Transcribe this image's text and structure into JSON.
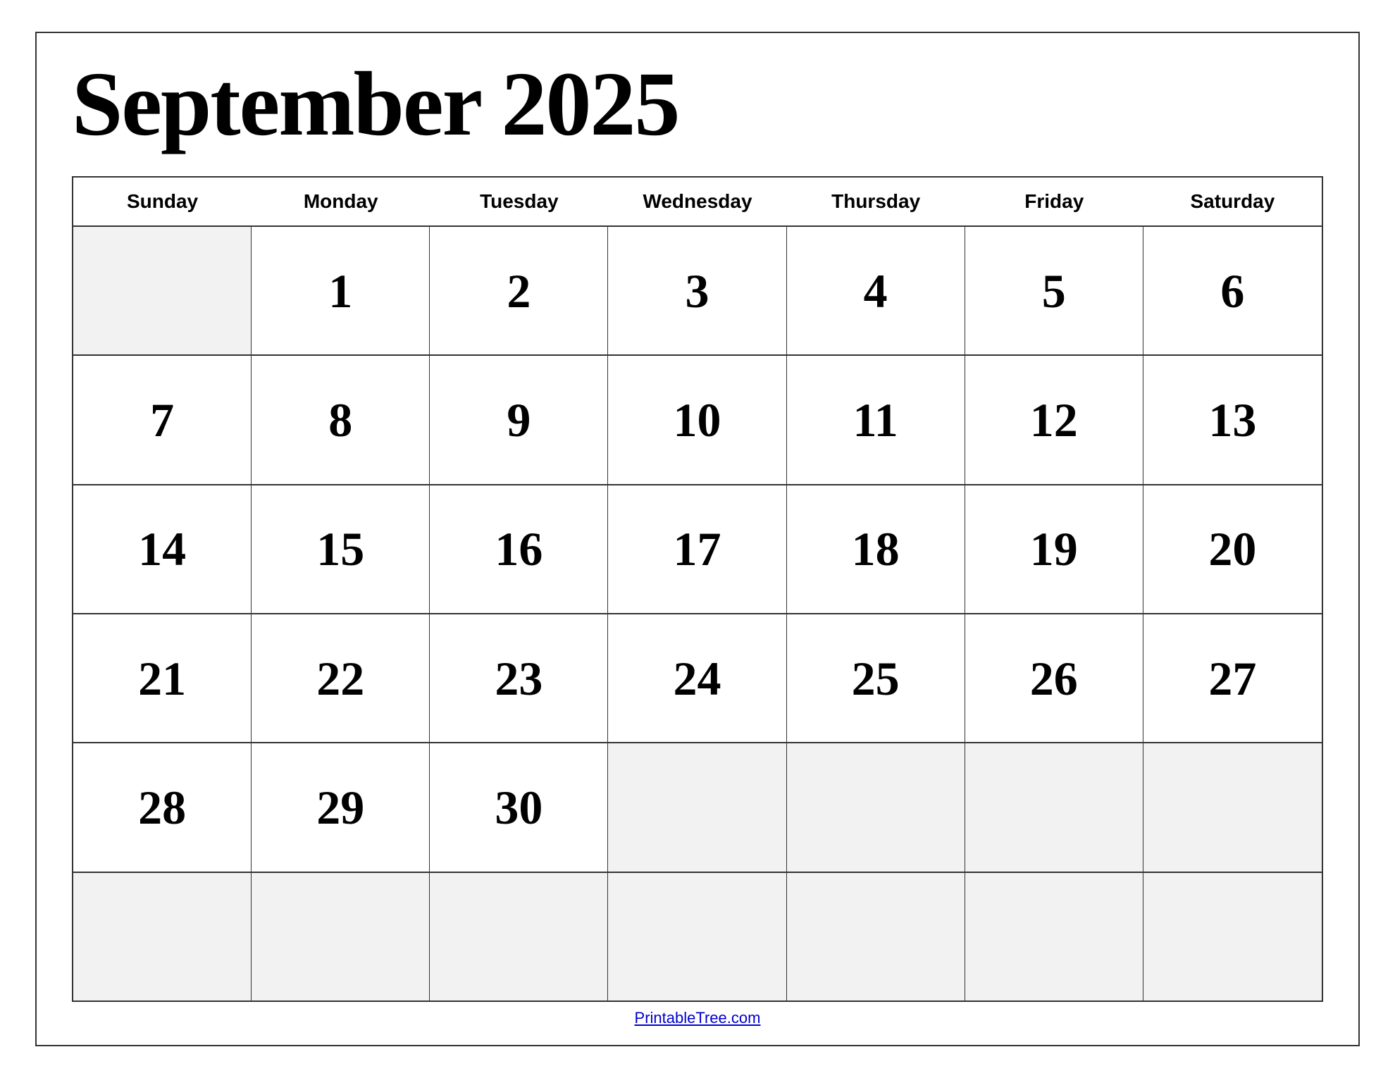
{
  "calendar": {
    "title": "September 2025",
    "month": "September",
    "year": "2025",
    "day_headers": [
      "Sunday",
      "Monday",
      "Tuesday",
      "Wednesday",
      "Thursday",
      "Friday",
      "Saturday"
    ],
    "weeks": [
      [
        {
          "day": "",
          "empty": true
        },
        {
          "day": "1",
          "empty": false
        },
        {
          "day": "2",
          "empty": false
        },
        {
          "day": "3",
          "empty": false
        },
        {
          "day": "4",
          "empty": false
        },
        {
          "day": "5",
          "empty": false
        },
        {
          "day": "6",
          "empty": false
        }
      ],
      [
        {
          "day": "7",
          "empty": false
        },
        {
          "day": "8",
          "empty": false
        },
        {
          "day": "9",
          "empty": false
        },
        {
          "day": "10",
          "empty": false
        },
        {
          "day": "11",
          "empty": false
        },
        {
          "day": "12",
          "empty": false
        },
        {
          "day": "13",
          "empty": false
        }
      ],
      [
        {
          "day": "14",
          "empty": false
        },
        {
          "day": "15",
          "empty": false
        },
        {
          "day": "16",
          "empty": false
        },
        {
          "day": "17",
          "empty": false
        },
        {
          "day": "18",
          "empty": false
        },
        {
          "day": "19",
          "empty": false
        },
        {
          "day": "20",
          "empty": false
        }
      ],
      [
        {
          "day": "21",
          "empty": false
        },
        {
          "day": "22",
          "empty": false
        },
        {
          "day": "23",
          "empty": false
        },
        {
          "day": "24",
          "empty": false
        },
        {
          "day": "25",
          "empty": false
        },
        {
          "day": "26",
          "empty": false
        },
        {
          "day": "27",
          "empty": false
        }
      ],
      [
        {
          "day": "28",
          "empty": false
        },
        {
          "day": "29",
          "empty": false
        },
        {
          "day": "30",
          "empty": false
        },
        {
          "day": "",
          "empty": true
        },
        {
          "day": "",
          "empty": true
        },
        {
          "day": "",
          "empty": true
        },
        {
          "day": "",
          "empty": true
        }
      ],
      [
        {
          "day": "",
          "empty": true
        },
        {
          "day": "",
          "empty": true
        },
        {
          "day": "",
          "empty": true
        },
        {
          "day": "",
          "empty": true
        },
        {
          "day": "",
          "empty": true
        },
        {
          "day": "",
          "empty": true
        },
        {
          "day": "",
          "empty": true
        }
      ]
    ],
    "footer_link_text": "PrintableTree.com",
    "footer_link_url": "https://PrintableTree.com"
  }
}
